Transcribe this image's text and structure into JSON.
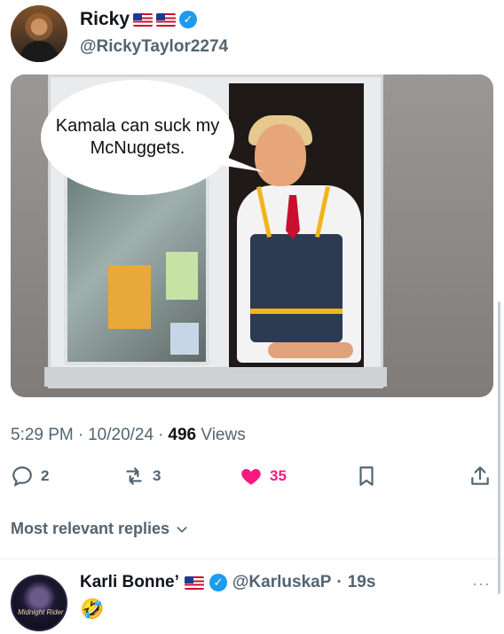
{
  "author": {
    "name": "Ricky",
    "handle": "@RickyTaylor2274"
  },
  "media": {
    "speech_bubble": "Kamala can suck my McNuggets."
  },
  "meta": {
    "time": "5:29 PM",
    "date": "10/20/24",
    "views_count": "496",
    "views_label": "Views"
  },
  "actions": {
    "replies": "2",
    "retweets": "3",
    "likes": "35"
  },
  "replies_section": {
    "label": "Most relevant replies"
  },
  "reply": {
    "name": "Karli Bonne’",
    "handle": "@KarluskaP",
    "time": "19s",
    "emoji": "🤣",
    "avatar_text": "Midnight Rider"
  },
  "colors": {
    "accent": "#1d9bf0",
    "like": "#f91880",
    "muted": "#536471"
  }
}
